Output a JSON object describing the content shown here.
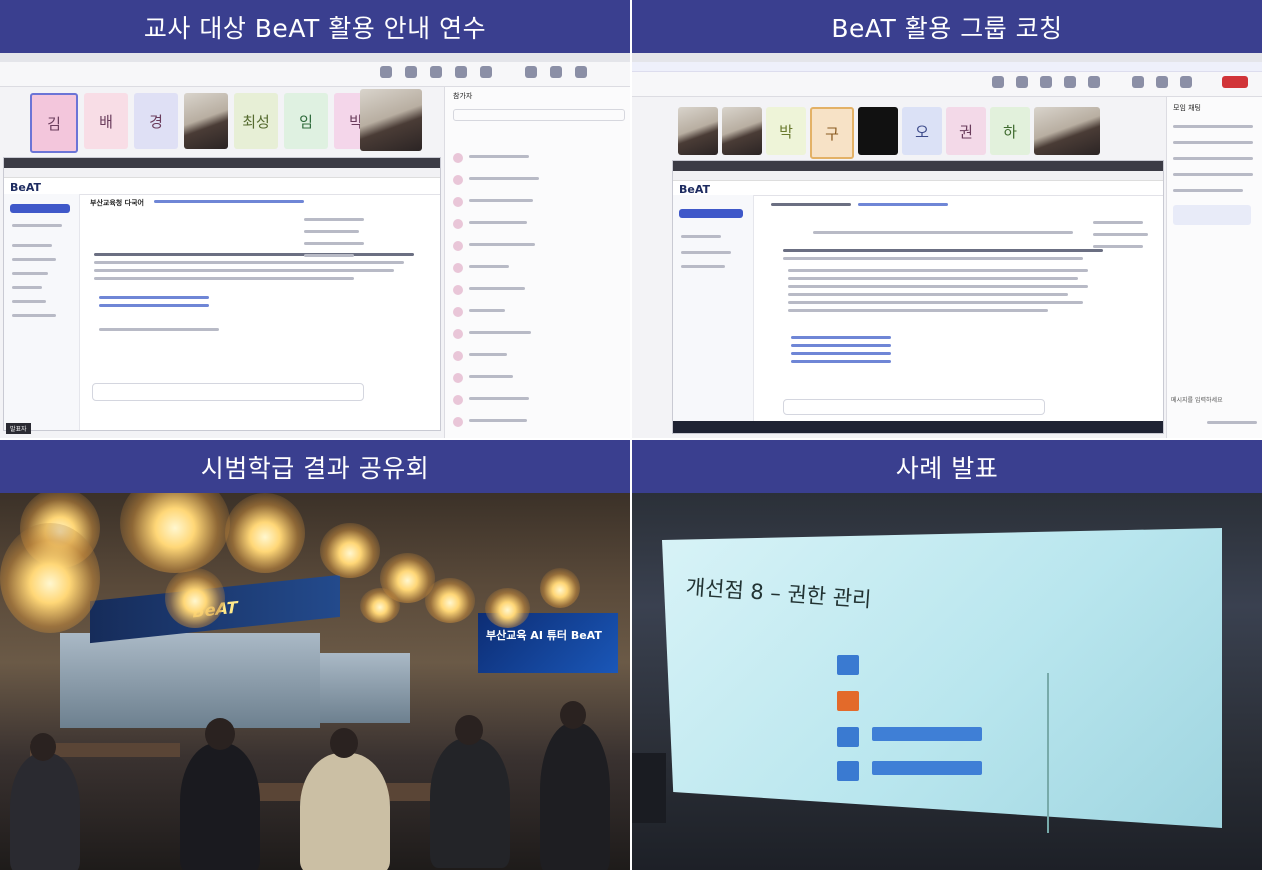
{
  "panels": {
    "top_left": {
      "title": "교사 대상 BeAT 활용 안내 연수"
    },
    "top_right": {
      "title": "BeAT 활용 그룹 코칭"
    },
    "bottom_left": {
      "title": "시범학급 결과 공유회"
    },
    "bottom_right": {
      "title": "사례 발표"
    }
  },
  "top_left_screen": {
    "tiles": [
      "김",
      "배",
      "경",
      "",
      "최성",
      "임",
      "박"
    ],
    "beat_logo": "BeAT",
    "doc_heading": "부산교육청 다국어",
    "side_panel_title": "참가자",
    "badge": "발표자"
  },
  "top_right_screen": {
    "tiles": [
      "",
      "",
      "박",
      "구",
      "",
      "오",
      "권",
      "하",
      ""
    ],
    "beat_logo": "BeAT",
    "side_panel_title": "모임 채팅",
    "chat_placeholder": "메시지를 입력하세요"
  },
  "bottom_left_scene": {
    "banner_text": "BeAT",
    "screen_text": "부산교육 AI 튜터 BeAT"
  },
  "bottom_right_scene": {
    "slide_title": "개선점 8 – 권한 관리"
  },
  "colors": {
    "header": "#3a3f8f",
    "accent": "#3f58c9"
  }
}
